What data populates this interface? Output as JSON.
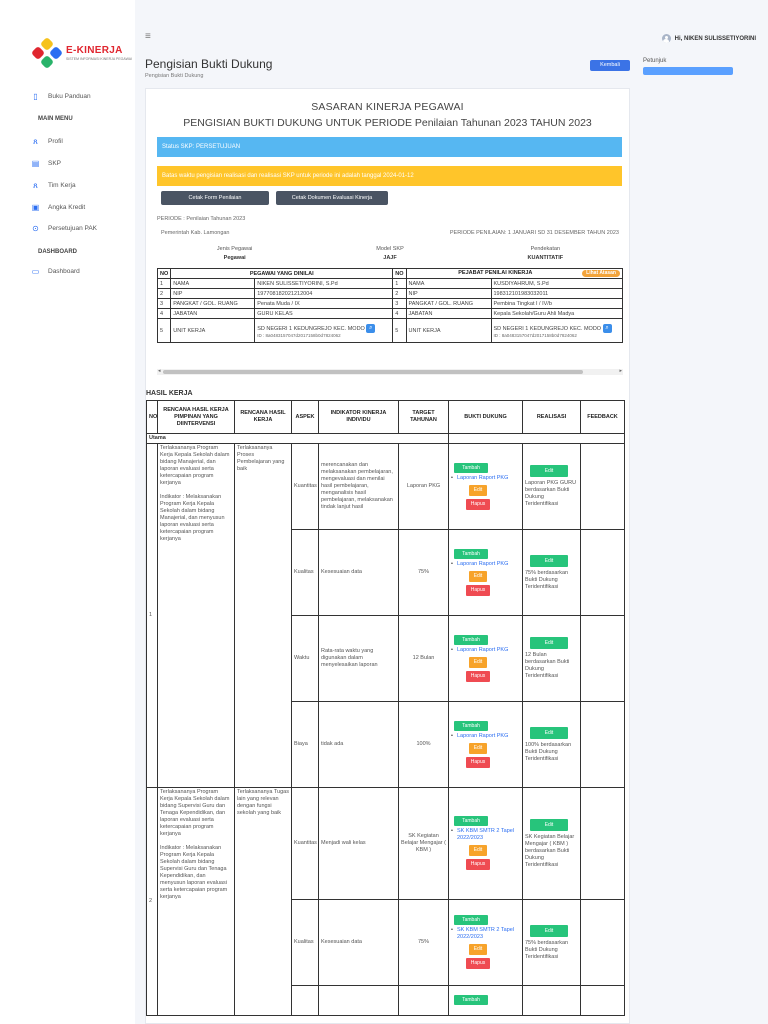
{
  "brand": {
    "name": "E-KINERJA",
    "tagline": "SISTEM INFORMASI KINERJA PEGAWAI"
  },
  "sidebar": {
    "buku_panduan": "Buku Panduan",
    "main_menu_head": "MAIN MENU",
    "items": [
      {
        "label": "Profil",
        "icon": "user-icon"
      },
      {
        "label": "SKP",
        "icon": "document-icon"
      },
      {
        "label": "Tim Kerja",
        "icon": "team-icon"
      },
      {
        "label": "Angka Kredit",
        "icon": "credit-icon"
      },
      {
        "label": "Persetujuan PAK",
        "icon": "approval-icon"
      }
    ],
    "dashboard_head": "DASHBOARD",
    "dashboard_item": "Dashboard"
  },
  "topbar": {
    "user_greeting": "Hi, NIKEN SULISSETIYORINI"
  },
  "header": {
    "title": "Pengisian Bukti Dukung",
    "breadcrumb": "Pengisian Bukti Dukung",
    "back_button": "Kembali",
    "petunjuk": "Petunjuk"
  },
  "card": {
    "heading": "SASARAN KINERJA PEGAWAI",
    "subheading": "PENGISIAN BUKTI DUKUNG UNTUK PERIODE Penilaian Tahunan 2023 TAHUN 2023",
    "status": "Status SKP: PERSETUJUAN",
    "deadline": "Batas waktu pengisian realisasi dan realisasi SKP untuk periode ini adalah tanggal 2024-01-12",
    "btn_form": "Cetak Form Penilaian",
    "btn_dokumen": "Cetak Dokumen Evaluasi Kinerja",
    "periode_left": "PERIODE : Penilaian Tahunan 2023",
    "pemda": "Pemerintah Kab. Lamongan",
    "periode_right": "PERIODE PENILAIAN: 1 JANUARI SD 31 DESEMBER TAHUN 2023",
    "info": [
      {
        "label": "Jenis Pegawai",
        "value": "Pegawai"
      },
      {
        "label": "Model SKP",
        "value": "JAJF"
      },
      {
        "label": "Pendekatan",
        "value": "KUANTITATIF"
      }
    ]
  },
  "pegawai": {
    "col_no": "NO",
    "left_head": "PEGAWAI YANG DINILAI",
    "right_head": "PEJABAT PENILAI KINERJA",
    "lihat_badge": "Lihat Atasan",
    "rows": [
      {
        "no": "1",
        "label": "NAMA",
        "value": "NIKEN SULISSETIYORINI, S.Pd",
        "rno": "1",
        "rlabel": "NAMA",
        "rvalue": "KUSDIYAHRUM, S.Pd"
      },
      {
        "no": "2",
        "label": "NIP",
        "value": "197708182021212004",
        "rno": "2",
        "rlabel": "NIP",
        "rvalue": "198312101983032011"
      },
      {
        "no": "3",
        "label": "PANGKAT / GOL. RUANG",
        "value": "Penata Muda / IX",
        "rno": "3",
        "rlabel": "PANGKAT / GOL. RUANG",
        "rvalue": "Pembina Tingkat I / IV/b"
      },
      {
        "no": "4",
        "label": "JABATAN",
        "value": "GURU KELAS",
        "rno": "4",
        "rlabel": "JABATAN",
        "rvalue": "Kepala Sekolah/Guru Ahli Madya"
      },
      {
        "no": "5",
        "label": "UNIT KERJA",
        "value": "SD NEGERI 1 KEDUNGREJO KEC. MODO",
        "id": "ID : 8a0483157047d2017158b0d7824062",
        "rno": "5",
        "rlabel": "UNIT KERJA",
        "rvalue": "SD NEGERI 1 KEDUNGREJO KEC. MODO",
        "rid": "ID : 8a0483157047d2017158b0d7824062"
      }
    ]
  },
  "hasil": {
    "title": "HASIL KERJA",
    "headers": [
      "NO",
      "RENCANA HASIL KERJA PIMPINAN YANG DIINTERVENSI",
      "RENCANA HASIL KERJA",
      "ASPEK",
      "INDIKATOR KINERJA INDIVIDU",
      "TARGET TAHUNAN",
      "BUKTI DUKUNG",
      "REALISASI",
      "FEEDBACK"
    ],
    "section": "Utama",
    "btn_tambah": "Tambah",
    "btn_edit": "Edit",
    "btn_hapus": "Hapus",
    "groups": [
      {
        "no": "1",
        "rhk_pimpinan": "Terlaksananya Program Kerja Kepala Sekolah dalam bidang Manajerial, dan laporan evaluasi serta ketercapaian program kerjanya\n\nIndikator : Melaksanakan Program Kerja Kepala Sekolah dalam bidang Manajerial, dan menyusun laporan evaluasi serta ketercapaian program kerjanya",
        "rhk": "Terlaksananya Proses Pembelajaran yang baik",
        "rows": [
          {
            "aspek": "Kuantitas",
            "indikator": "merencanakan dan melaksanakan pembelajaran, mengevaluasi dan menilai hasil pembelajaran, menganalisis hasil pembelajaran, melaksanakan tindak lanjut hasil",
            "target": "Laporan PKG",
            "bukti": "Laporan Raport PKG",
            "realisasi": "Laporan PKG GURU berdasarkan Bukti Dukung Teridentifikasi"
          },
          {
            "aspek": "Kualitas",
            "indikator": "Kesesuaian data",
            "target": "75%",
            "bukti": "Laporan Raport PKG",
            "realisasi": "75% berdasarkan Bukti Dukung Teridentifikasi"
          },
          {
            "aspek": "Waktu",
            "indikator": "Rata-rata waktu yang digunakan dalam menyelesaikan laporan",
            "target": "12 Bulan",
            "bukti": "Laporan Raport PKG",
            "realisasi": "12 Bulan berdasarkan Bukti Dukung Teridentifikasi"
          },
          {
            "aspek": "Biaya",
            "indikator": "tidak ada",
            "target": "100%",
            "bukti": "Laporan Raport PKG",
            "realisasi": "100% berdasarkan Bukti Dukung Teridentifikasi"
          }
        ]
      },
      {
        "no": "2",
        "rhk_pimpinan": "Terlaksananya Program Kerja Kepala Sekolah dalam bidang Supervisi Guru dan Tenaga Kependidikan, dan laporan evaluasi serta ketercapaian program kerjanya\n\nIndikator : Melaksanakan Program Kerja Kepala Sekolah dalam bidang Supervisi Guru dan Tenaga Kependidikan, dan menyusun laporan evaluasi serta ketercapaian program kerjanya",
        "rhk": "Terlaksananya Tugas lain yang relevan dengan fungsi sekolah yang baik",
        "rows": [
          {
            "aspek": "Kuantitas",
            "indikator": "Menjadi wali kelas",
            "target": "SK Kegiatan Belajar Mengajar ( KBM )",
            "bukti": "SK KBM SMTR 2 Tapel 2022/2023",
            "realisasi": "SK Kegiatan Belajar Mengajar ( KBM ) berdasarkan Bukti Dukung Teridentifikasi"
          },
          {
            "aspek": "Kualitas",
            "indikator": "Kesesuaian data",
            "target": "75%",
            "bukti": "SK KBM SMTR 2 Tapel 2022/2023",
            "realisasi": "75% berdasarkan Bukti Dukung Teridentifikasi"
          }
        ]
      }
    ]
  },
  "colors": {
    "primary": "#3b73e6",
    "info": "#56b7f2",
    "warning": "#ffc52a",
    "success": "#27c47b",
    "danger": "#ef4b52",
    "orange": "#f7a32a",
    "dark": "#4a5463"
  }
}
